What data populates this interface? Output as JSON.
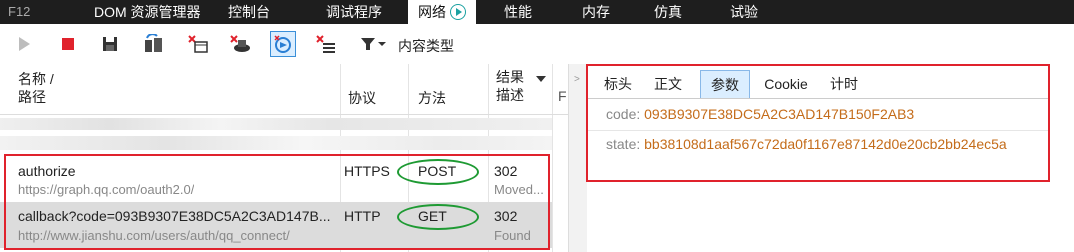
{
  "tabs": {
    "f12": "F12",
    "items": [
      "DOM 资源管理器",
      "控制台",
      "调试程序",
      "网络",
      "性能",
      "内存",
      "仿真",
      "试验"
    ],
    "active_index": 3
  },
  "toolbar": {
    "filter_label": "内容类型"
  },
  "table": {
    "headers": {
      "name_line1": "名称 /",
      "name_line2": "路径",
      "protocol": "协议",
      "method": "方法",
      "result_line1": "结果",
      "result_line2": "描述",
      "extra": "F"
    },
    "rows": [
      {
        "name": "authorize",
        "path": "https://graph.qq.com/oauth2.0/",
        "protocol": "HTTPS",
        "method": "POST",
        "result": "302",
        "desc": "Moved..."
      },
      {
        "name": "callback?code=093B9307E38DC5A2C3AD147B...",
        "path": "http://www.jianshu.com/users/auth/qq_connect/",
        "protocol": "HTTP",
        "method": "GET",
        "result": "302",
        "desc": "Found"
      }
    ]
  },
  "details": {
    "tabs": [
      "标头",
      "正文",
      "参数",
      "Cookie",
      "计时"
    ],
    "active_tab": 2,
    "params": [
      {
        "key": "code: ",
        "value": "093B9307E38DC5A2C3AD147B150F2AB3"
      },
      {
        "key": "state: ",
        "value": "bb38108d1aaf567c72da0f1167e87142d0e20cb2bb24ec5a"
      }
    ]
  },
  "colors": {
    "highlight_red": "#e0222c",
    "ellipse_green": "#1e9a33",
    "param_value": "#c46c1a",
    "selected_row_bg": "#dcdcdc"
  }
}
